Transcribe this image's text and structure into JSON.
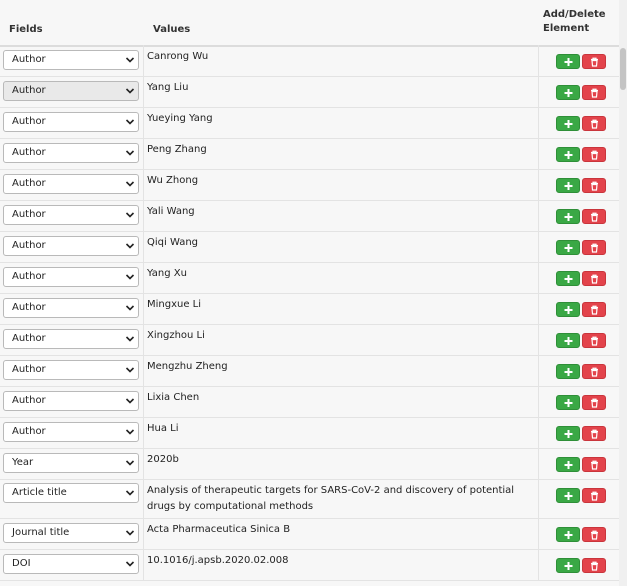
{
  "header": {
    "fields": "Fields",
    "values": "Values",
    "actions_line1": "Add/Delete",
    "actions_line2": "Element"
  },
  "rows": [
    {
      "field": "Author",
      "value": "Canrong Wu"
    },
    {
      "field": "Author",
      "value": "Yang Liu"
    },
    {
      "field": "Author",
      "value": "Yueying Yang"
    },
    {
      "field": "Author",
      "value": "Peng Zhang"
    },
    {
      "field": "Author",
      "value": "Wu Zhong"
    },
    {
      "field": "Author",
      "value": "Yali Wang"
    },
    {
      "field": "Author",
      "value": "Qiqi Wang"
    },
    {
      "field": "Author",
      "value": "Yang Xu"
    },
    {
      "field": "Author",
      "value": "Mingxue Li"
    },
    {
      "field": "Author",
      "value": "Xingzhou Li"
    },
    {
      "field": "Author",
      "value": "Mengzhu Zheng"
    },
    {
      "field": "Author",
      "value": "Lixia Chen"
    },
    {
      "field": "Author",
      "value": "Hua Li"
    },
    {
      "field": "Year",
      "value": "2020b"
    },
    {
      "field": "Article title",
      "value_line1": "Analysis of therapeutic targets for SARS-CoV-2 and discovery of potential",
      "value_line2": "drugs by computational methods"
    },
    {
      "field": "Journal title",
      "value": "Acta Pharmaceutica Sinica B"
    },
    {
      "field": "DOI",
      "value": "10.1016/j.apsb.2020.02.008"
    }
  ],
  "colors": {
    "add": "#3aa845",
    "delete": "#e3434b"
  },
  "icons": {
    "add": "plus-icon",
    "delete": "trash-icon",
    "select": "chevron-down-icon"
  }
}
